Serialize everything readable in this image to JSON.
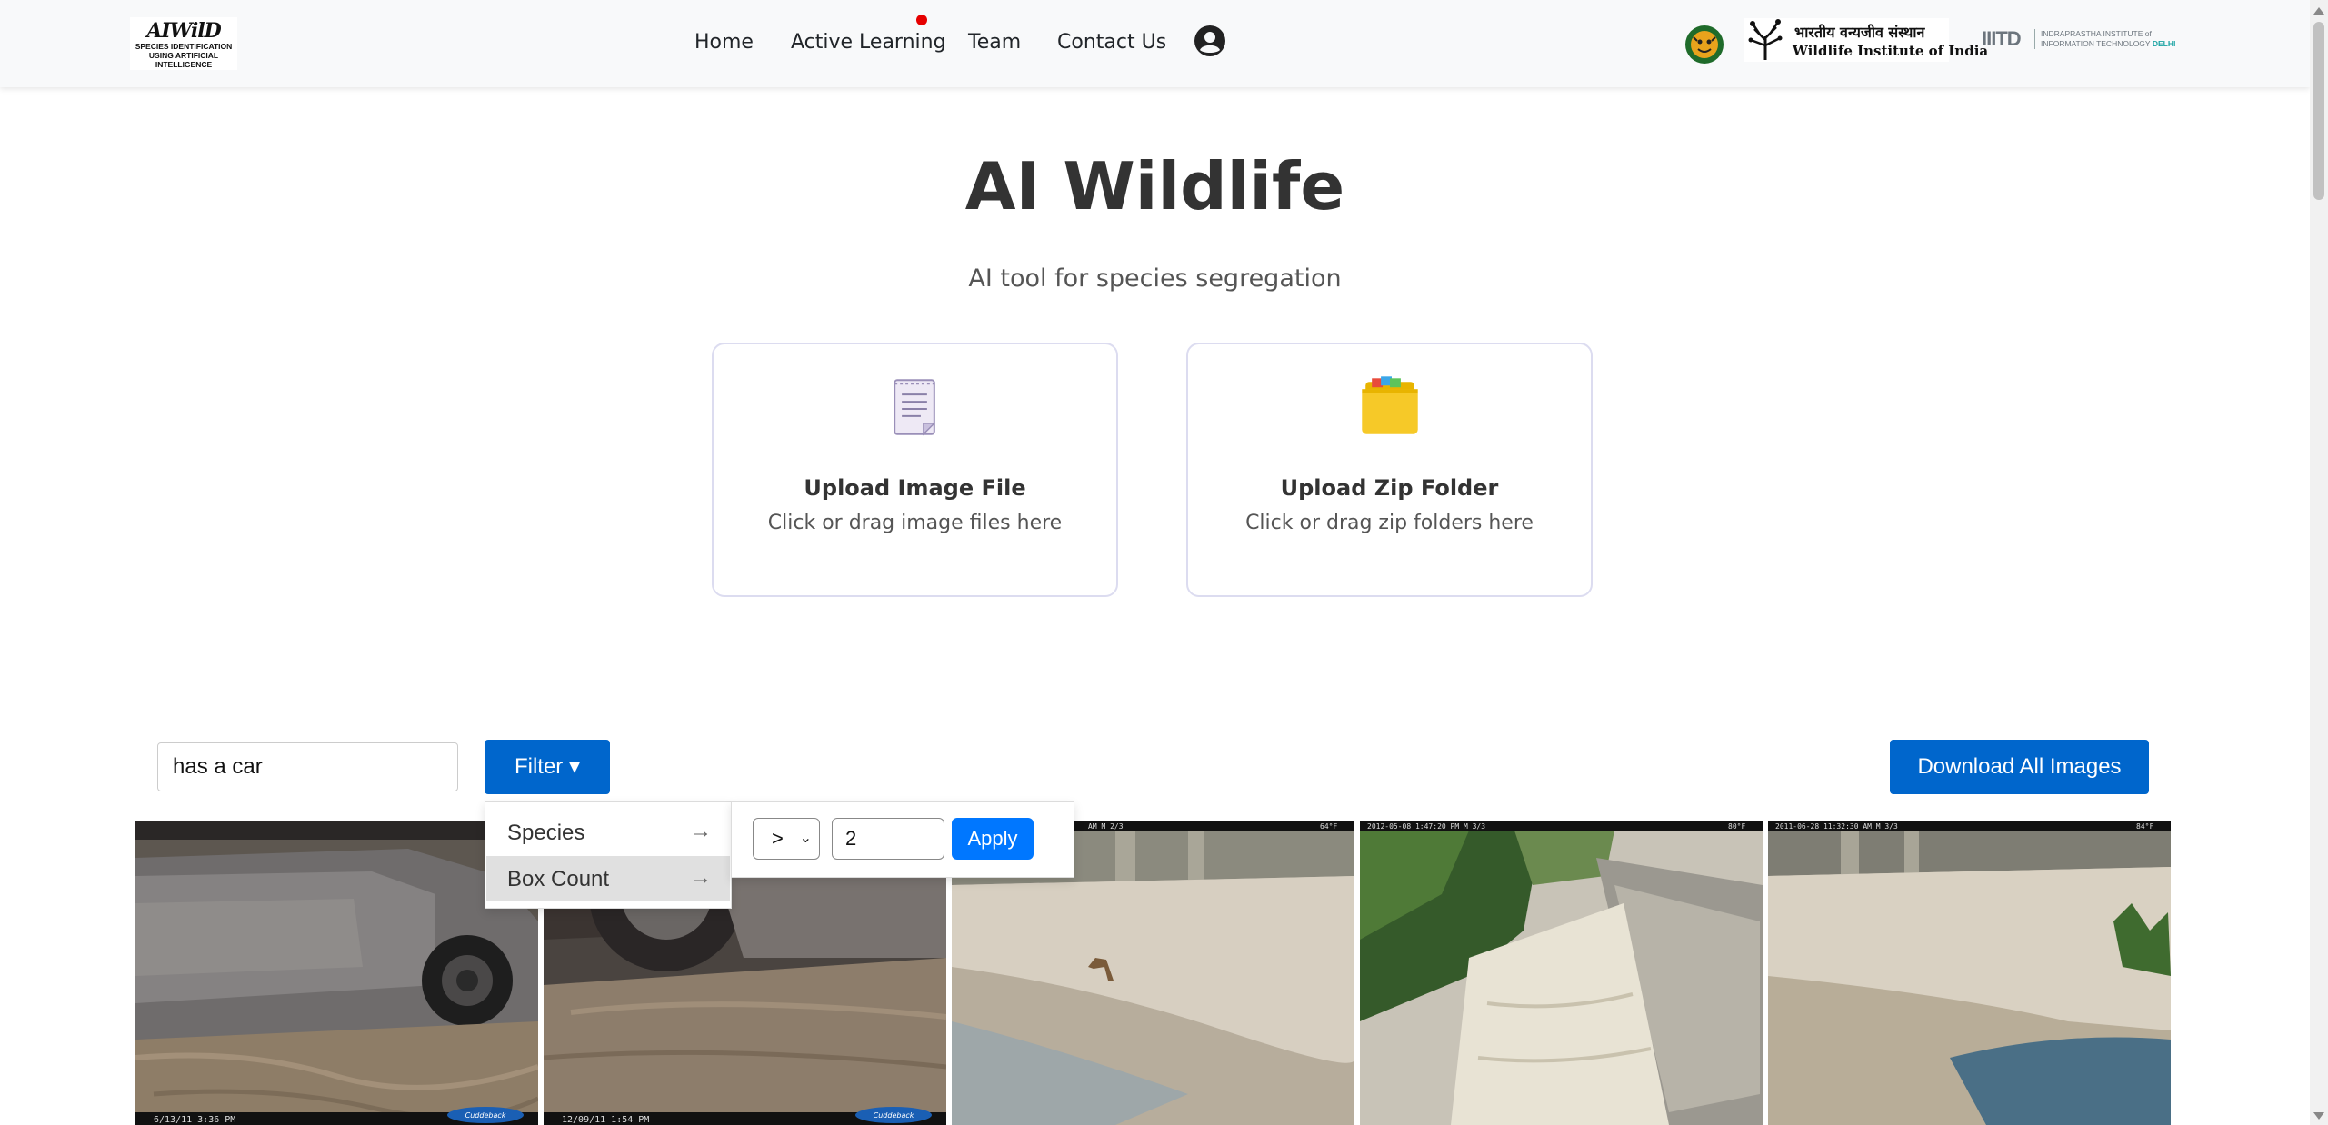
{
  "brand": {
    "name": "AIWilD",
    "tagline_line1": "SPECIES IDENTIFICATION",
    "tagline_line2": "USING ARTIFICIAL INTELLIGENCE"
  },
  "nav": {
    "items": [
      {
        "label": "Home"
      },
      {
        "label": "Active Learning",
        "has_notification": true
      },
      {
        "label": "Team"
      },
      {
        "label": "Contact Us"
      }
    ],
    "profile_icon": "user-circle-icon"
  },
  "partners": {
    "wii_hindi": "भारतीय वन्यजीव संस्थान",
    "wii_english": "Wildlife Institute of India",
    "iiit_mark": "IIITD",
    "iiit_line1": "INDRAPRASTHA INSTITUTE of",
    "iiit_line2": "INFORMATION TECHNOLOGY",
    "iiit_city": "DELHI"
  },
  "hero": {
    "title": "AI Wildlife",
    "subtitle": "AI tool for species segregation"
  },
  "upload": {
    "image_card": {
      "icon": "document-icon",
      "title": "Upload Image File",
      "desc": "Click or drag image files here"
    },
    "zip_card": {
      "icon": "folder-icon",
      "title": "Upload Zip Folder",
      "desc": "Click or drag zip folders here"
    }
  },
  "toolbar": {
    "search_value": "has a car",
    "filter_label": "Filter ▾",
    "download_label": "Download All Images"
  },
  "filter_menu": {
    "items": [
      {
        "label": "Species",
        "arrow": "→"
      },
      {
        "label": "Box Count",
        "arrow": "→",
        "active": true
      }
    ],
    "box_count": {
      "operator": ">",
      "value": "2",
      "apply_label": "Apply"
    }
  },
  "gallery": {
    "images": [
      {
        "stamp": "6/13/11   3:36 PM",
        "badge": "Cuddeback"
      },
      {
        "stamp": "12/09/11   1:54 PM",
        "badge": "Cuddeback"
      },
      {
        "stamp": "AM   M 2/3",
        "temp": "64°F"
      },
      {
        "stamp": "2012-05-08  1:47:20 PM   M 3/3",
        "temp": "80°F"
      },
      {
        "stamp": "2011-06-28 11:32:30 AM   M 3/3",
        "temp": "84°F"
      }
    ]
  },
  "colors": {
    "primary": "#0066cc",
    "apply": "#0077ff",
    "notification": "#e60000"
  }
}
